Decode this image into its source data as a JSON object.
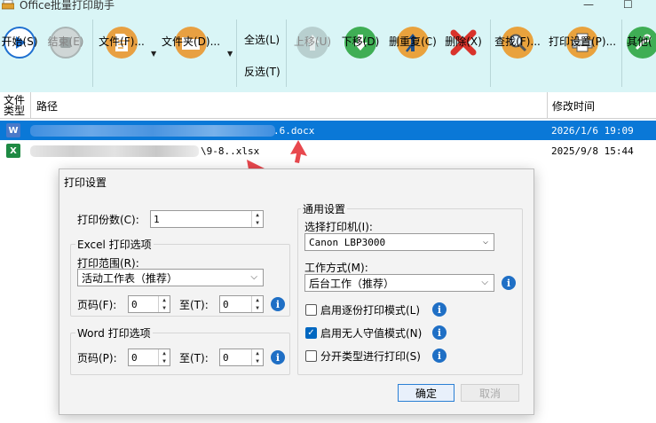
{
  "window": {
    "title": "Office批量打印助手"
  },
  "toolbar": {
    "start": "开始(S)",
    "stop": "结束(E)",
    "file": "文件(F)...",
    "folder": "文件夹(D)...",
    "select_all": "全选(L)",
    "invert": "反选(T)",
    "move_up": "上移(U)",
    "move_down": "下移(D)",
    "dedupe": "删重复(C)",
    "delete": "删除(X)",
    "find": "查找(F)...",
    "print_settings": "打印设置(P)...",
    "other": "其他("
  },
  "list": {
    "col_type": "文件\n类型",
    "col_type_l1": "文件",
    "col_type_l2": "类型",
    "col_path": "路径",
    "col_time": "修改时间",
    "rows": [
      {
        "type_icon": "W",
        "path_suffix": ".6.docx",
        "time": "2026/1/6 19:09"
      },
      {
        "type_icon": "X",
        "path_suffix": "\\9-8..xlsx",
        "time": "2025/9/8 15:44"
      }
    ]
  },
  "dialog": {
    "title": "打印设置",
    "copies_label": "打印份数(C):",
    "copies_value": "1",
    "excel_group": "Excel 打印选项",
    "range_label": "打印范围(R):",
    "range_value": "活动工作表（推荐）",
    "page_label": "页码(F):",
    "page_from": "0",
    "to_label": "至(T):",
    "page_to": "0",
    "word_group": "Word 打印选项",
    "word_page_label": "页码(P):",
    "word_page_from": "0",
    "word_to_label": "至(T):",
    "word_page_to": "0",
    "general_group": "通用设置",
    "printer_label": "选择打印机(I):",
    "printer_value": "Canon LBP3000",
    "mode_label": "工作方式(M):",
    "mode_value": "后台工作（推荐）",
    "opt_collate": "启用逐份打印模式(L)",
    "opt_unattended": "启用无人守值模式(N)",
    "opt_split_type": "分开类型进行打印(S)",
    "opt_collate_checked": false,
    "opt_unattended_checked": true,
    "opt_split_type_checked": false,
    "ok": "确定",
    "cancel": "取消"
  },
  "colors": {
    "toolbar_bg": "#d9f5f6",
    "selected_row": "#0a78d7",
    "accent_blue": "#1f6fc5"
  }
}
